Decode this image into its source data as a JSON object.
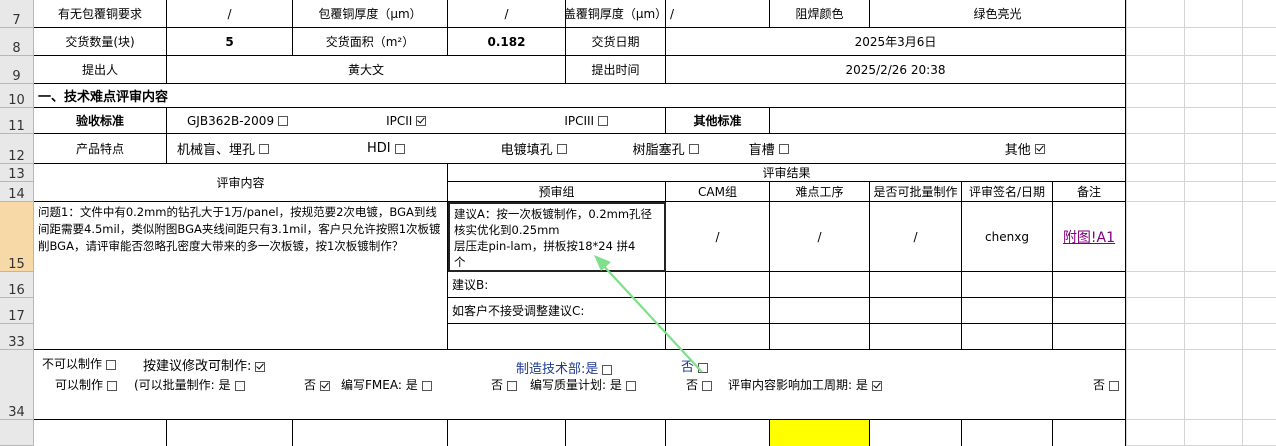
{
  "rows": [
    "7",
    "8",
    "9",
    "10",
    "11",
    "12",
    "13",
    "14",
    "15",
    "16",
    "17",
    "33",
    "34"
  ],
  "r7": {
    "a": "有无包覆铜要求",
    "b": "/",
    "c": "包覆铜厚度（μm）",
    "d": "/",
    "e": "盖覆铜厚度（μm）",
    "f": "/",
    "g": "阻焊颜色",
    "h": "绿色亮光"
  },
  "r8": {
    "a": "交货数量(块)",
    "b": "5",
    "c": "交货面积（m²）",
    "d": "0.182",
    "e": "交货日期",
    "h": "2025年3月6日"
  },
  "r9": {
    "a": "提出人",
    "b": "黄大文",
    "e": "提出时间",
    "h": "2025/2/26 20:38"
  },
  "r10": {
    "title": "一、技术难点评审内容"
  },
  "r11": {
    "a": "验收标准",
    "opt1": "GJB362B-2009",
    "opt2": "IPCII",
    "opt3": "IPCIII",
    "other": "其他标准"
  },
  "r12": {
    "a": "产品特点",
    "f1": "机械盲、埋孔",
    "f2": "HDI",
    "f3": "电镀填孔",
    "f4": "树脂塞孔",
    "f5": "盲槽",
    "f6": "其他"
  },
  "r13": {
    "review": "评审内容",
    "result": "评审结果"
  },
  "r14": {
    "c1": "预审组",
    "c2": "CAM组",
    "c3": "难点工序",
    "c4": "是否可批量制作",
    "c5": "评审签名/日期",
    "c6": "备注"
  },
  "r15": {
    "question": "问题1：文件中有0.2mm的钻孔大于1万/panel，按规范要2次电镀，BGA到线间距需要4.5mil，类似附图BGA夹线间距只有3.1mil，客户只允许按照1次板镀削BGA，请评审能否忽略孔密度大带来的多一次板镀，按1次板镀制作？",
    "sugA_l1": "建议A：按一次板镀制作，0.2mm孔径",
    "sugA_l2": "核实优化到0.25mm",
    "sugA_l3": "层压走pin-lam，拼板按18*24 拼4",
    "sugA_l4": "个",
    "cam": "/",
    "proc": "/",
    "batch": "/",
    "sign": "chenxg",
    "note": "附图!A1"
  },
  "r16": {
    "sugB": "建议B:"
  },
  "r17": {
    "sugC": "如客户不接受调整建议C:"
  },
  "r34": {
    "cannot": "不可以制作",
    "modify": "按建议修改可制作:",
    "dept": "制造技术部:是",
    "no1": "否",
    "can": "可以制作",
    "batch": "(可以批量制作: 是",
    "no2": "否",
    "fmea": "编写FMEA: 是",
    "no3": "否",
    "quality": "编写质量计划: 是",
    "no4": "否",
    "cycle": "评审内容影响加工周期: 是",
    "no5": "否"
  },
  "colors": {
    "highlight": "#ffff00",
    "link": "#800080",
    "arrow": "#7ee08a",
    "selected_row": "#f7d9a8"
  }
}
